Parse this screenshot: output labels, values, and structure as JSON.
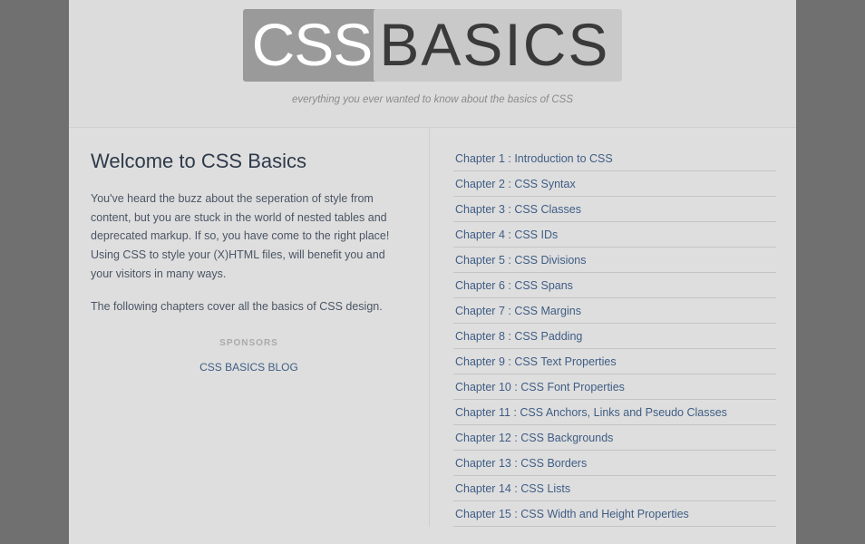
{
  "header": {
    "logo_css": "CSS",
    "logo_basics": "BASICS",
    "tagline": "everything you ever wanted to know about the basics of CSS"
  },
  "main": {
    "title": "Welcome to CSS Basics",
    "intro": "You've heard the buzz about the seperation of style from content, but you are stuck in the world of nested tables and deprecated markup. If so, you have come to the right place! Using CSS to style your (X)HTML files, will benefit you and your visitors in many ways.",
    "note": "The following chapters cover all the basics of CSS design.",
    "sponsors_label": "SPONSORS",
    "sponsor_link": "CSS BASICS BLOG"
  },
  "chapters": [
    "Chapter 1 : Introduction to CSS",
    "Chapter 2 : CSS Syntax",
    "Chapter 3 : CSS Classes",
    "Chapter 4 : CSS IDs",
    "Chapter 5 : CSS Divisions",
    "Chapter 6 : CSS Spans",
    "Chapter 7 : CSS Margins",
    "Chapter 8 : CSS Padding",
    "Chapter 9 : CSS Text Properties",
    "Chapter 10 : CSS Font Properties",
    "Chapter 11 : CSS Anchors, Links and Pseudo Classes",
    "Chapter 12 : CSS Backgrounds",
    "Chapter 13 : CSS Borders",
    "Chapter 14 : CSS Lists",
    "Chapter 15 : CSS Width and Height Properties"
  ]
}
